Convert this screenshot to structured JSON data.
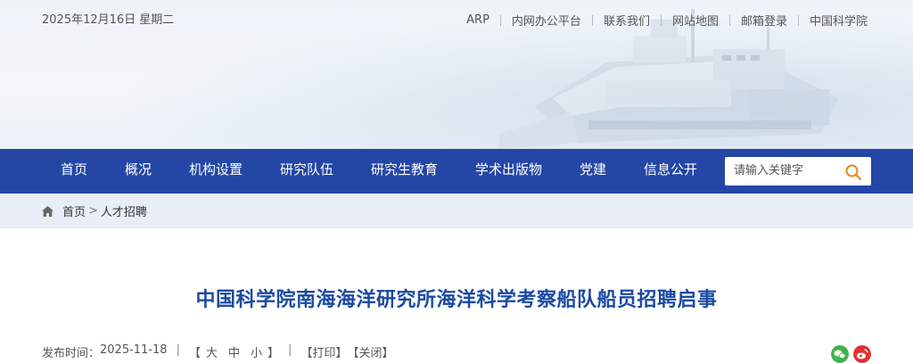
{
  "header": {
    "date": "2025年12月16日 星期二",
    "links": [
      {
        "label": "ARP"
      },
      {
        "label": "内网办公平台"
      },
      {
        "label": "联系我们"
      },
      {
        "label": "网站地图"
      },
      {
        "label": "邮箱登录"
      },
      {
        "label": "中国科学院"
      }
    ]
  },
  "nav": {
    "items": [
      {
        "label": "首页"
      },
      {
        "label": "概况"
      },
      {
        "label": "机构设置"
      },
      {
        "label": "研究队伍"
      },
      {
        "label": "研究生教育"
      },
      {
        "label": "学术出版物"
      },
      {
        "label": "党建"
      },
      {
        "label": "信息公开"
      }
    ],
    "search_placeholder": "请输入关键字",
    "search_icon": "search-icon",
    "color": "#2447a6"
  },
  "breadcrumb": {
    "home_icon": "home-icon",
    "items": [
      "首页",
      "人才招聘"
    ],
    "separator": ">"
  },
  "article": {
    "title": "中国科学院南海海洋研究所海洋科学考察船队船员招聘启事",
    "title_color": "#1c4aa2",
    "meta": {
      "publish_label": "发布时间：",
      "publish_date": "2025-11-18",
      "divider": "|",
      "font_open": "【",
      "font_large": "大",
      "font_medium": "中",
      "font_small": "小",
      "font_close": "】",
      "print": "【打印】",
      "close": "【关闭】"
    },
    "share_icons": [
      "wechat-icon",
      "weibo-icon"
    ]
  }
}
